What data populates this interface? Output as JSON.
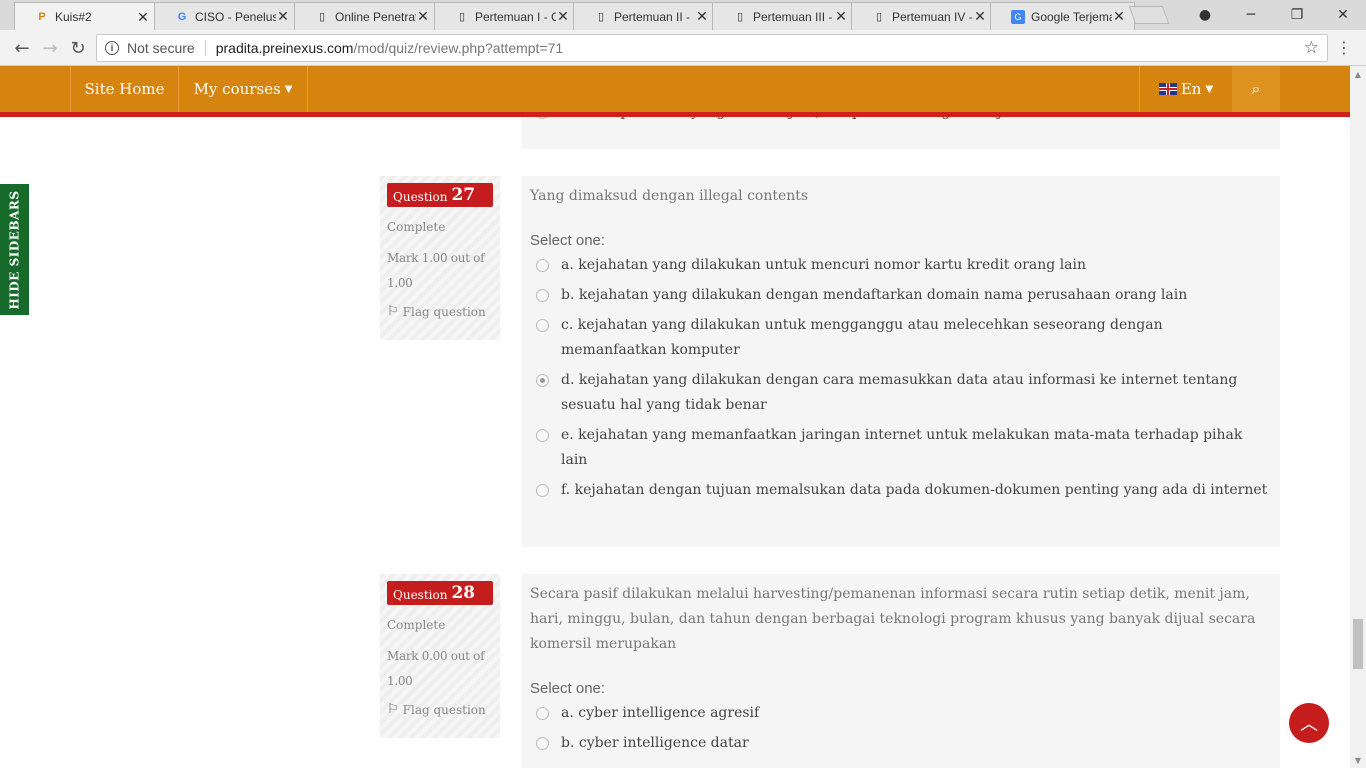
{
  "browser": {
    "tabs": [
      {
        "title": "Kuis#2",
        "icon": "P"
      },
      {
        "title": "CISO - Penelusu",
        "icon": "G"
      },
      {
        "title": "Online Penetrat",
        "icon": "doc"
      },
      {
        "title": "Pertemuan I - C",
        "icon": "doc"
      },
      {
        "title": "Pertemuan II - ",
        "icon": "doc"
      },
      {
        "title": "Pertemuan III - ",
        "icon": "doc"
      },
      {
        "title": "Pertemuan IV - ",
        "icon": "doc"
      },
      {
        "title": "Google Terjema",
        "icon": "GT"
      }
    ],
    "security_label": "Not secure",
    "url_host": "pradita.preinexus.com",
    "url_path": "/mod/quiz/review.php?attempt=71"
  },
  "navbar": {
    "site_home": "Site Home",
    "my_courses": "My courses",
    "language": "En"
  },
  "sidebar_toggle": "HIDE SIDEBARS",
  "previous_answer": "f. Suatu peristiwa yang akan terjadi, tetapi tidak mungkin terjadi",
  "questions": [
    {
      "word": "Question",
      "number": "27",
      "state": "Complete",
      "grade": "Mark 1.00 out of 1.00",
      "flag": "Flag question",
      "text": "Yang dimaksud dengan illegal contents",
      "prompt": "Select one:",
      "answers": [
        "a. kejahatan yang dilakukan untuk mencuri nomor kartu kredit orang lain",
        "b. kejahatan yang dilakukan dengan mendaftarkan domain nama perusahaan orang lain",
        "c. kejahatan yang dilakukan untuk mengganggu atau melecehkan seseorang dengan memanfaatkan komputer",
        "d. kejahatan yang dilakukan dengan cara memasukkan data atau informasi ke internet tentang sesuatu hal yang tidak benar",
        "e. kejahatan yang memanfaatkan jaringan internet untuk melakukan mata-mata terhadap pihak lain",
        "f. kejahatan dengan tujuan memalsukan data pada dokumen-dokumen penting yang ada di internet"
      ],
      "selected": 3
    },
    {
      "word": "Question",
      "number": "28",
      "state": "Complete",
      "grade": "Mark 0.00 out of 1.00",
      "flag": "Flag question",
      "text": "Secara pasif dilakukan melalui harvesting/pemanenan informasi secara rutin setiap detik, menit jam, hari, minggu, bulan, dan tahun dengan berbagai teknologi program khusus yang banyak dijual secara komersil merupakan",
      "prompt": "Select one:",
      "answers": [
        "a. cyber intelligence agresif",
        "b. cyber intelligence datar"
      ],
      "selected": -1
    }
  ],
  "colors": {
    "navbar": "#d68410",
    "accent_red": "#c51d1d",
    "sidebar_toggle": "#166a2a"
  }
}
